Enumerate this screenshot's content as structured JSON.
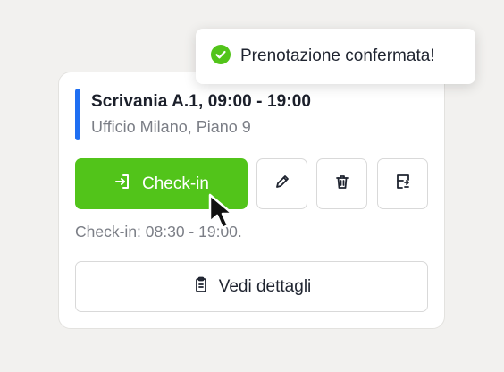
{
  "toast": {
    "message": "Prenotazione confermata!",
    "icon": "check-circle-icon",
    "color": "#52c41a"
  },
  "booking": {
    "title": "Scrivania A.1, 09:00 - 19:00",
    "location": "Ufficio Milano, Piano 9",
    "accent_color": "#1f6ff2"
  },
  "actions": {
    "checkin_label": "Check-in",
    "checkin_icon": "login-icon",
    "checkin_color": "#52c41a",
    "edit_icon": "pencil-icon",
    "delete_icon": "trash-icon",
    "move_icon": "move-desk-icon"
  },
  "checkin_hint": "Check-in: 08:30 - 19:00.",
  "details": {
    "label": "Vedi dettagli",
    "icon": "clipboard-icon"
  },
  "cursor": {
    "icon": "mouse-pointer-icon"
  }
}
